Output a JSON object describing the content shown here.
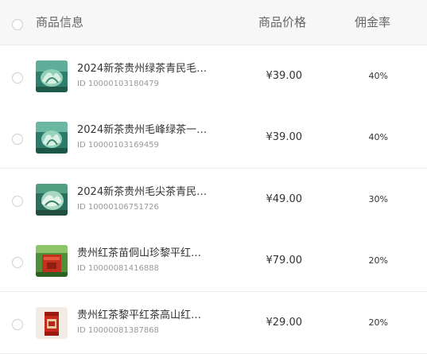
{
  "header": {
    "product_info": "商品信息",
    "product_price": "商品价格",
    "commission_rate": "佣金率"
  },
  "rows": [
    {
      "title": "2024新茶贵州绿茶青民毛…",
      "id": "ID 10000103180479",
      "price": "¥39.00",
      "rate": "40%",
      "thumb": "green-tea-leaves-image"
    },
    {
      "title": "2024新茶贵州毛峰绿茶一…",
      "id": "ID 10000103169459",
      "price": "¥39.00",
      "rate": "40%",
      "thumb": "green-tea-leaves-image"
    },
    {
      "title": "2024新茶贵州毛尖茶青民…",
      "id": "ID 10000106751726",
      "price": "¥49.00",
      "rate": "30%",
      "thumb": "green-tea-leaves-image"
    },
    {
      "title": "贵州红茶苗侗山珍黎平红…",
      "id": "ID 10000081416888",
      "price": "¥79.00",
      "rate": "20%",
      "thumb": "red-tea-box-image"
    },
    {
      "title": "贵州红茶黎平红茶高山红…",
      "id": "ID 10000081387868",
      "price": "¥29.00",
      "rate": "20%",
      "thumb": "red-tea-canister-image"
    }
  ]
}
